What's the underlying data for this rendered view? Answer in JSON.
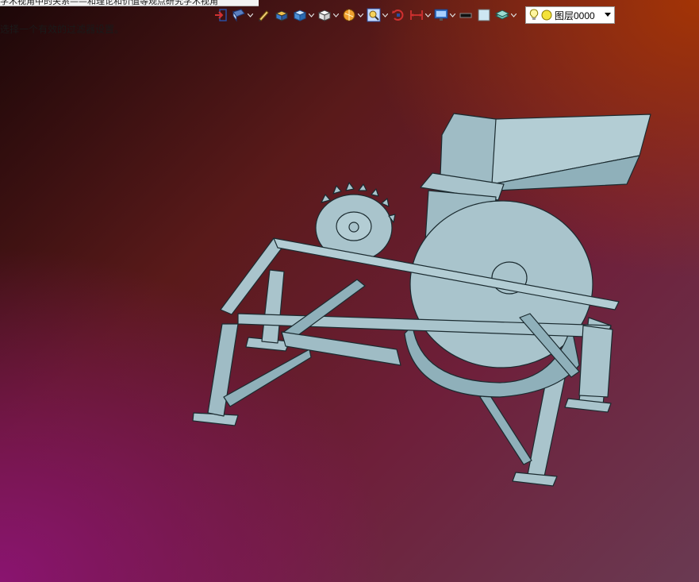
{
  "window": {
    "title_fragment": "学术视角中的关系——和理论和价值等观点研究学术视角"
  },
  "status": {
    "message": "选择一个有效的过滤器设置。"
  },
  "toolbar": {
    "icons": [
      "exit-icon",
      "view-orientation-icon",
      "sketch-pencil-icon",
      "solid-box-icon",
      "shaded-box-icon",
      "view-cube-icon",
      "render-sphere-icon",
      "zoom-fit-icon",
      "rotate-icon",
      "dimension-icon",
      "display-monitor-icon",
      "color-swatch-black-icon",
      "color-swatch-light-icon",
      "layer-stack-icon"
    ],
    "layer_selector": {
      "value": "图层0000",
      "icons": [
        "bulb-icon",
        "sun-icon"
      ]
    }
  },
  "model": {
    "name": "shredder-assembly",
    "colors": {
      "fill": "#a9c4cc",
      "edge": "#1b2b30",
      "shade": "#8fb0ba"
    }
  }
}
